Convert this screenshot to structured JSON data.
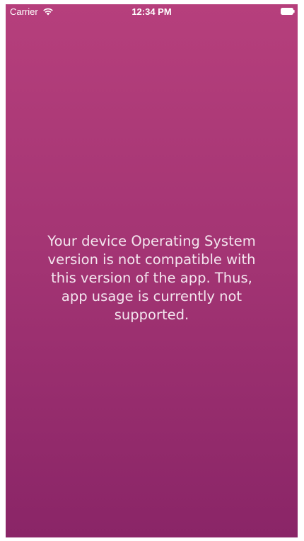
{
  "status_bar": {
    "carrier": "Carrier",
    "time": "12:34 PM",
    "icons": [
      "wifi-icon",
      "battery-icon"
    ]
  },
  "main": {
    "message": "Your device Operating System version is not compatible with this version of the app. Thus, app usage is currently not supported."
  },
  "colors": {
    "background_top": "#b63f7c",
    "background_bottom": "#8a2567",
    "text": "#ffffff"
  }
}
